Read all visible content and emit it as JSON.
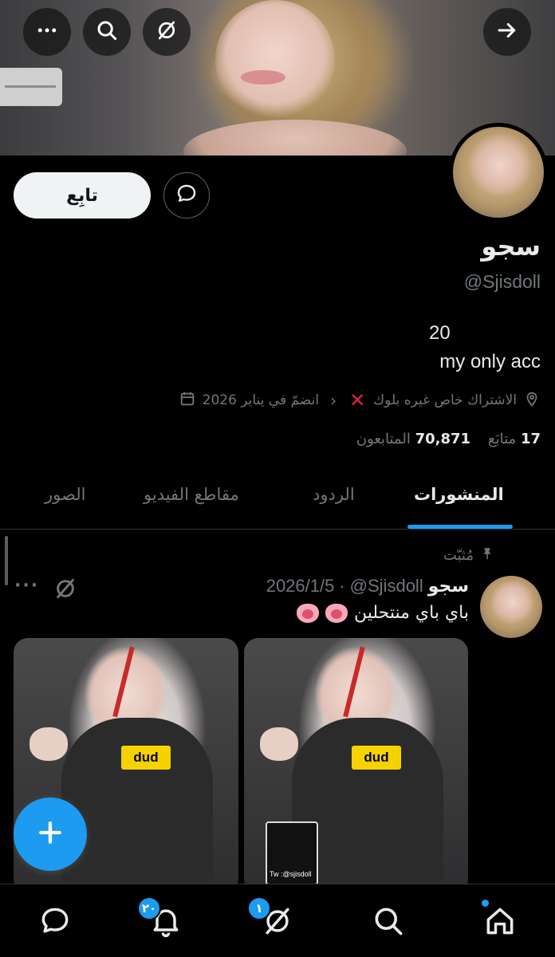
{
  "header": {
    "more_icon": "more-horizontal-icon",
    "search_icon": "search-icon",
    "grok_icon": "grok-icon",
    "forward_icon": "arrow-right-icon"
  },
  "profile": {
    "follow_label": "تابِع",
    "name": "سجو",
    "handle": "@Sjisdoll",
    "bio_line1": "20",
    "bio_line2": "my only acc",
    "location": "الاشتراك خاص غيره بلوك",
    "joined": "انضمّ في يناير 2026",
    "following_count": "17",
    "following_label": "متابَع",
    "followers_count": "70,871",
    "followers_label": "المتابعون"
  },
  "tabs": [
    {
      "label": "المنشورات",
      "active": true
    },
    {
      "label": "الردود",
      "active": false
    },
    {
      "label": "مقاطع الفيديو",
      "active": false
    },
    {
      "label": "الصور",
      "active": false
    }
  ],
  "post": {
    "pinned_label": "مُثبّت",
    "author_name": "سجو",
    "author_handle": "@Sjisdoll",
    "date": "2026/1/5",
    "text": "باي باي منتحلين",
    "media_logo": "dud",
    "media_phone_text": "Tw :@sjisdoll"
  },
  "bottom_nav": {
    "notifications_badge": "٢٠",
    "grok_badge": "١"
  },
  "colors": {
    "accent": "#1d9bf0",
    "background": "#000000",
    "muted_text": "#71767b"
  }
}
